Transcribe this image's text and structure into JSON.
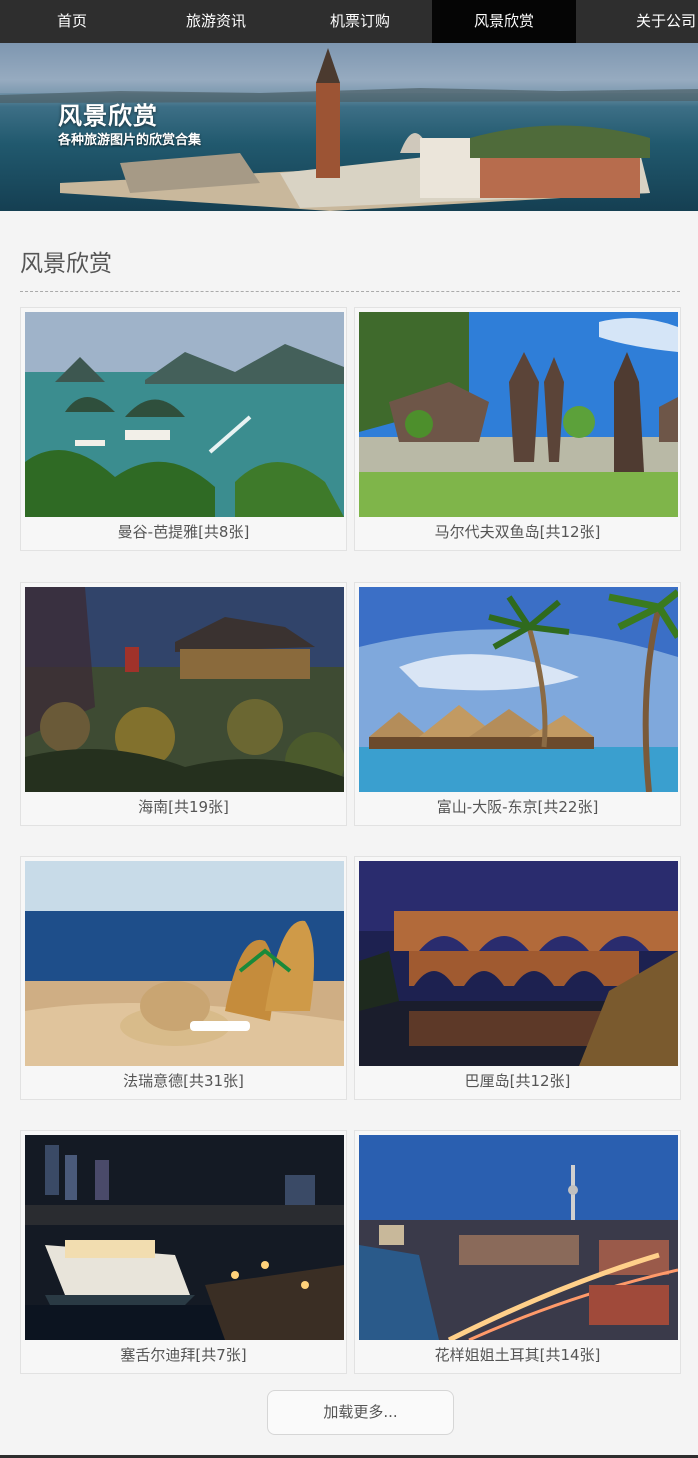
{
  "nav": {
    "items": [
      "首页",
      "旅游资讯",
      "机票订购",
      "风景欣赏",
      "关于公司"
    ],
    "active_index": 3
  },
  "banner": {
    "title": "风景欣赏",
    "subtitle": "各种旅游图片的欣赏合集"
  },
  "section": {
    "title": "风景欣赏"
  },
  "gallery": [
    {
      "caption": "曼谷-芭提雅[共8张]"
    },
    {
      "caption": "马尔代夫双鱼岛[共12张]"
    },
    {
      "caption": "海南[共19张]"
    },
    {
      "caption": "富山-大阪-东京[共22张]"
    },
    {
      "caption": "法瑞意德[共31张]"
    },
    {
      "caption": "巴厘岛[共12张]"
    },
    {
      "caption": "塞舌尔迪拜[共7张]"
    },
    {
      "caption": "花样姐姐土耳其[共14张]"
    }
  ],
  "load_more": {
    "label": "加载更多..."
  },
  "colors": {
    "nav_bg": "#2e2e2e",
    "nav_active": "#050505",
    "page_bg": "#f4f4f4"
  }
}
